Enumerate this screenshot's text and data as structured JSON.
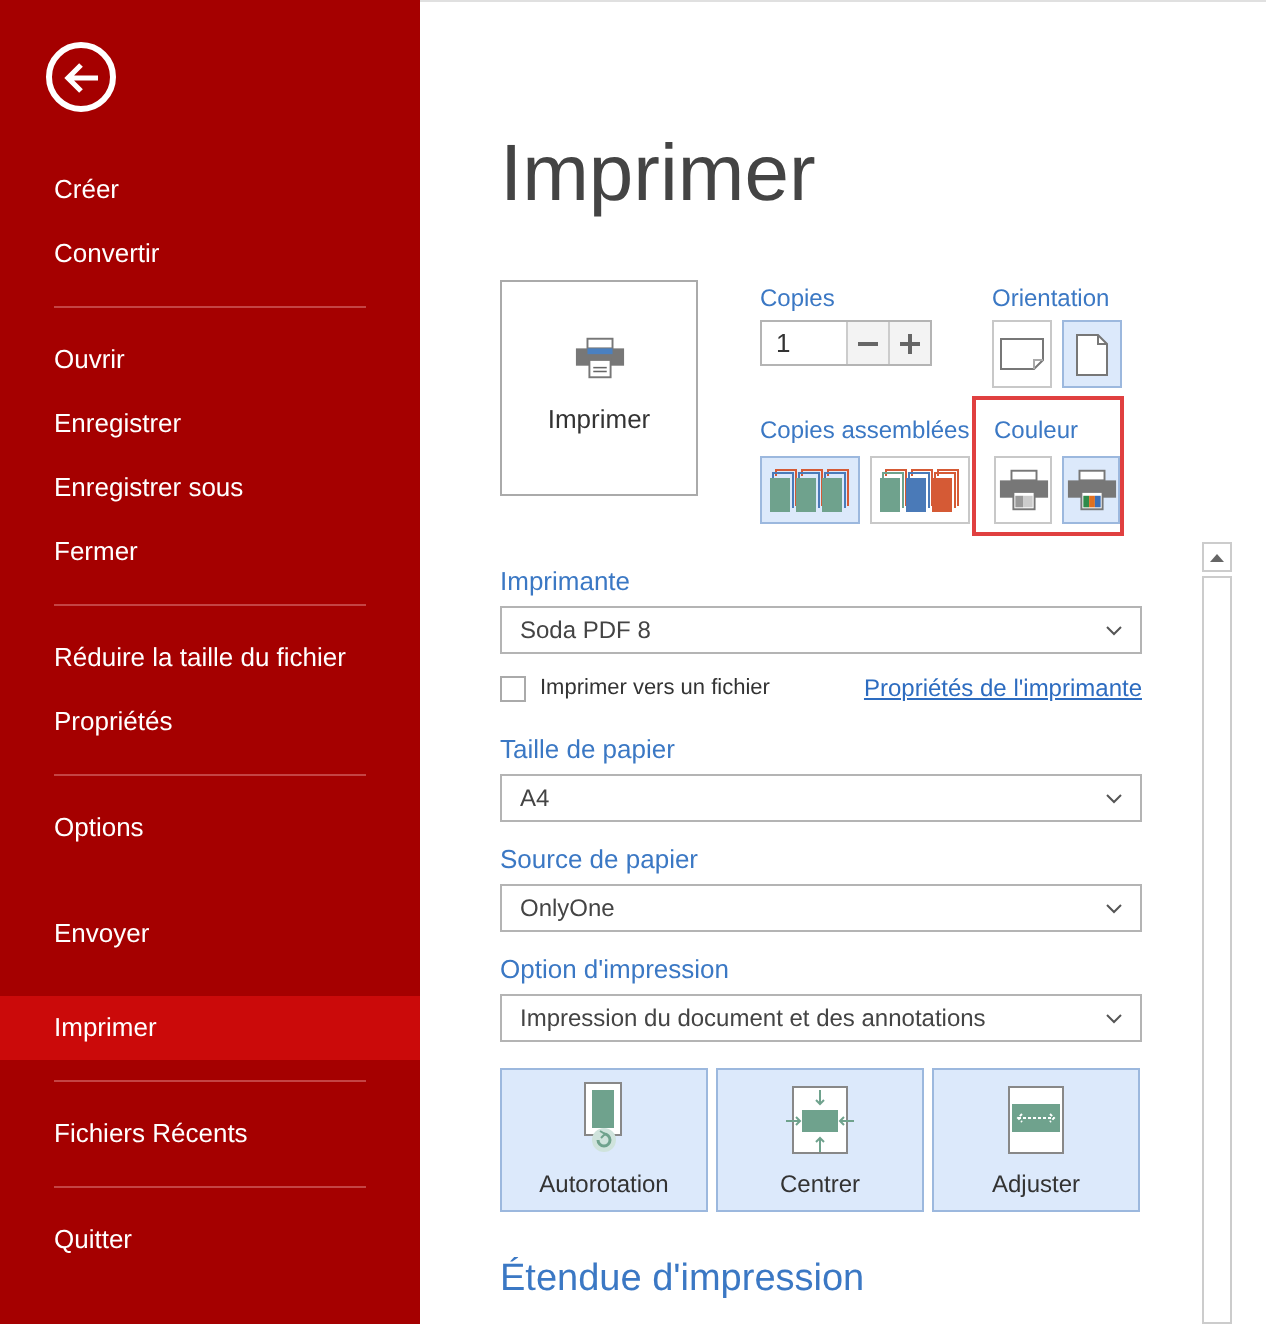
{
  "sidebar": {
    "groups": [
      {
        "items": [
          {
            "label": "Créer",
            "selected": false
          },
          {
            "label": "Convertir",
            "selected": false
          }
        ]
      },
      {
        "items": [
          {
            "label": "Ouvrir",
            "selected": false
          },
          {
            "label": "Enregistrer",
            "selected": false
          },
          {
            "label": "Enregistrer sous",
            "selected": false
          },
          {
            "label": "Fermer",
            "selected": false
          }
        ]
      },
      {
        "items": [
          {
            "label": "Réduire la taille du fichier",
            "selected": false
          },
          {
            "label": "Propriétés",
            "selected": false
          }
        ]
      },
      {
        "items": [
          {
            "label": "Options",
            "selected": false
          }
        ]
      },
      {
        "items": [
          {
            "label": "Envoyer",
            "selected": false
          },
          {
            "label": "Imprimer",
            "selected": true
          }
        ]
      },
      {
        "items": [
          {
            "label": "Fichiers Récents",
            "selected": false
          }
        ]
      },
      {
        "items": [
          {
            "label": "Quitter",
            "selected": false
          }
        ]
      }
    ]
  },
  "page_title": "Imprimer",
  "print_button": {
    "label": "Imprimer"
  },
  "copies": {
    "label": "Copies",
    "value": "1"
  },
  "orientation": {
    "label": "Orientation",
    "options": [
      {
        "kind": "landscape",
        "selected": false
      },
      {
        "kind": "portrait",
        "selected": true
      }
    ]
  },
  "collation": {
    "label": "Copies assemblées",
    "options": [
      {
        "kind": "collated",
        "selected": true
      },
      {
        "kind": "uncollated",
        "selected": false
      }
    ]
  },
  "color": {
    "label": "Couleur",
    "highlighted": true,
    "options": [
      {
        "kind": "grayscale",
        "selected": false
      },
      {
        "kind": "color",
        "selected": true
      }
    ]
  },
  "printer": {
    "label": "Imprimante",
    "value": "Soda PDF 8"
  },
  "print_to_file": {
    "label": "Imprimer vers un fichier",
    "checked": false
  },
  "printer_properties_link": "Propriétés de l'imprimante",
  "paper_size": {
    "label": "Taille de papier",
    "value": "A4"
  },
  "paper_source": {
    "label": "Source de papier",
    "value": "OnlyOne"
  },
  "print_option": {
    "label": "Option d'impression",
    "value": "Impression du document et des annotations"
  },
  "layout_buttons": [
    {
      "kind": "autorotate",
      "label": "Autorotation"
    },
    {
      "kind": "center",
      "label": "Centrer"
    },
    {
      "kind": "fit",
      "label": "Adjuster"
    }
  ],
  "section_heading": "Étendue d'impression"
}
